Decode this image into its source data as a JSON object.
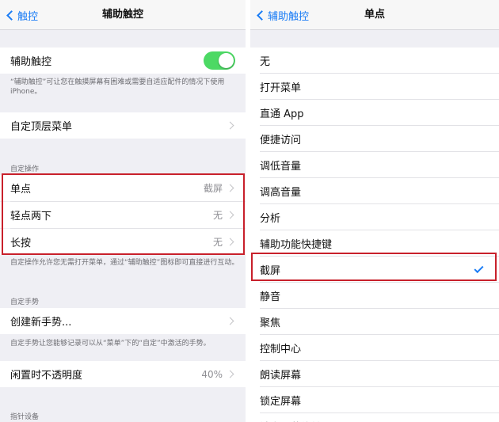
{
  "left": {
    "nav": {
      "back": "触控",
      "title": "辅助触控"
    },
    "assistive_touch": {
      "label": "辅助触控",
      "on": true
    },
    "assistive_note": "“辅助触控”可让您在触摸屏幕有困难或需要自适应配件的情况下使用iPhone。",
    "top_menu": {
      "label": "自定顶层菜单"
    },
    "custom_actions_header": "自定操作",
    "actions": [
      {
        "label": "单点",
        "value": "截屏"
      },
      {
        "label": "轻点两下",
        "value": "无"
      },
      {
        "label": "长按",
        "value": "无"
      }
    ],
    "actions_note": "自定操作允许您无需打开菜单，通过“辅助触控”图标即可直接进行互动。",
    "custom_gestures_header": "自定手势",
    "create_gesture": {
      "label": "创建新手势..."
    },
    "gestures_note": "自定手势让您能够记录可以从“菜单”下的“自定”中激活的手势。",
    "idle_opacity": {
      "label": "闲置时不透明度",
      "value": "40%"
    },
    "pointer_header": "指针设备"
  },
  "right": {
    "nav": {
      "back": "辅助触控",
      "title": "单点"
    },
    "options": [
      "无",
      "打开菜单",
      "直通 App",
      "便捷访问",
      "调低音量",
      "调高音量",
      "分析",
      "辅助功能快捷键",
      "截屏",
      "静音",
      "聚焦",
      "控制中心",
      "朗读屏幕",
      "锁定屏幕",
      "锁定屏幕旋转"
    ],
    "selected": "截屏"
  },
  "colors": {
    "accent": "#1a7cf5",
    "toggle_on": "#4cd964",
    "highlight": "#c8202b"
  }
}
